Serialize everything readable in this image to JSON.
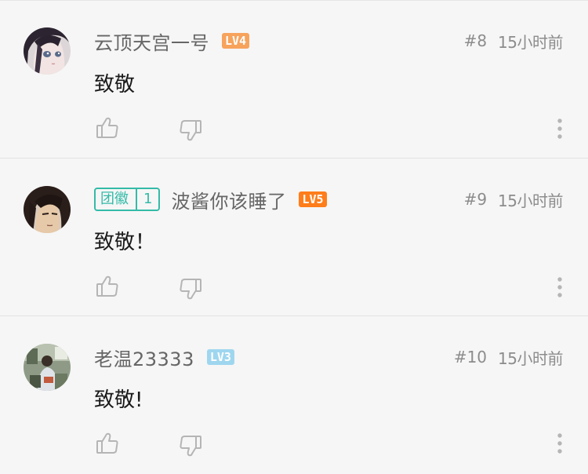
{
  "comments": [
    {
      "username": "云顶天宫一号",
      "level": "LV4",
      "level_color": "#f7a35c",
      "badge": null,
      "floor": "#8",
      "time": "15小时前",
      "text": "致敬",
      "avatar_icon": "anime-girl-avatar"
    },
    {
      "username": "波酱你该睡了",
      "level": "LV5",
      "level_color": "#ff7d1a",
      "badge": {
        "name": "团徽",
        "number": "1"
      },
      "floor": "#9",
      "time": "15小时前",
      "text": "致敬！",
      "avatar_icon": "anime-man-avatar"
    },
    {
      "username": "老温23333",
      "level": "LV3",
      "level_color": "#9fd6ef",
      "badge": null,
      "floor": "#10",
      "time": "15小时前",
      "text": "致敬!",
      "avatar_icon": "photo-avatar"
    }
  ],
  "actions": {
    "like_icon": "thumbs-up-icon",
    "dislike_icon": "thumbs-down-icon",
    "more_icon": "more-vertical-icon"
  }
}
